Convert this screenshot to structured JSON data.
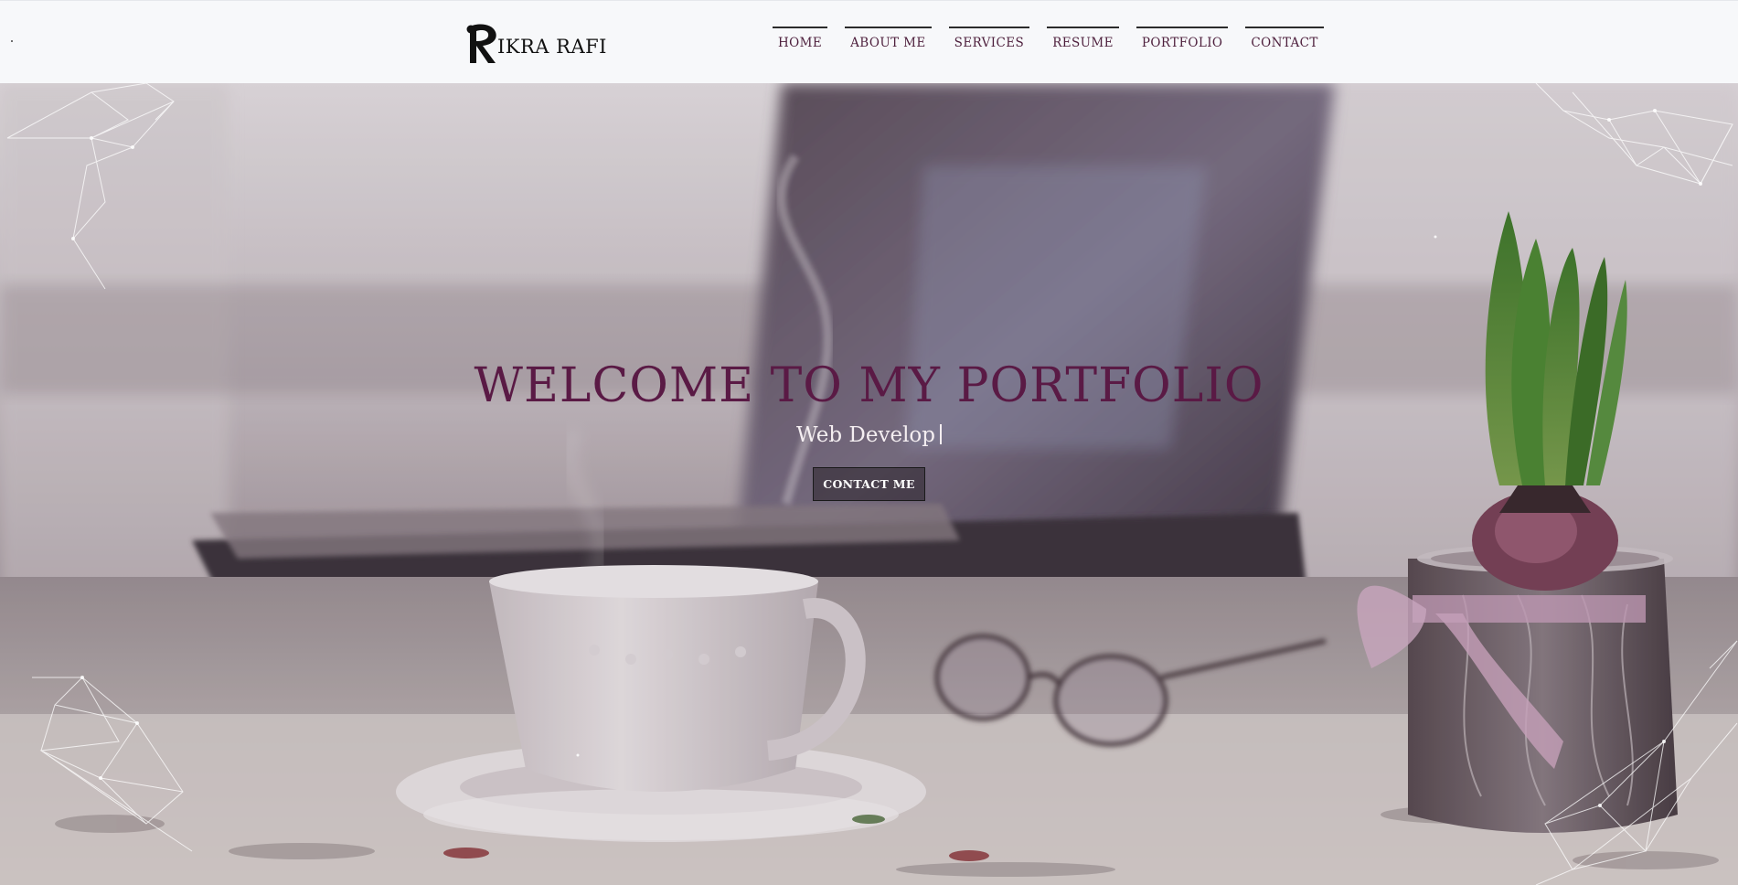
{
  "nav": {
    "brand": {
      "text": "IKRA RAFI",
      "logo_icon": "letter-r-logo-icon"
    },
    "items": [
      {
        "label": "HOME"
      },
      {
        "label": "ABOUT ME"
      },
      {
        "label": "SERVICES"
      },
      {
        "label": "RESUME"
      },
      {
        "label": "PORTFOLIO"
      },
      {
        "label": "CONTACT"
      }
    ]
  },
  "hero": {
    "title": "WELCOME TO MY PORTFOLIO",
    "typed_text": "Web Develop",
    "cta_label": "CONTACT ME"
  },
  "colors": {
    "nav_bg": "#f7f8fa",
    "accent": "#5a1a45",
    "nav_text": "#4d1f3c",
    "hero_subtitle": "#f4eef1"
  }
}
